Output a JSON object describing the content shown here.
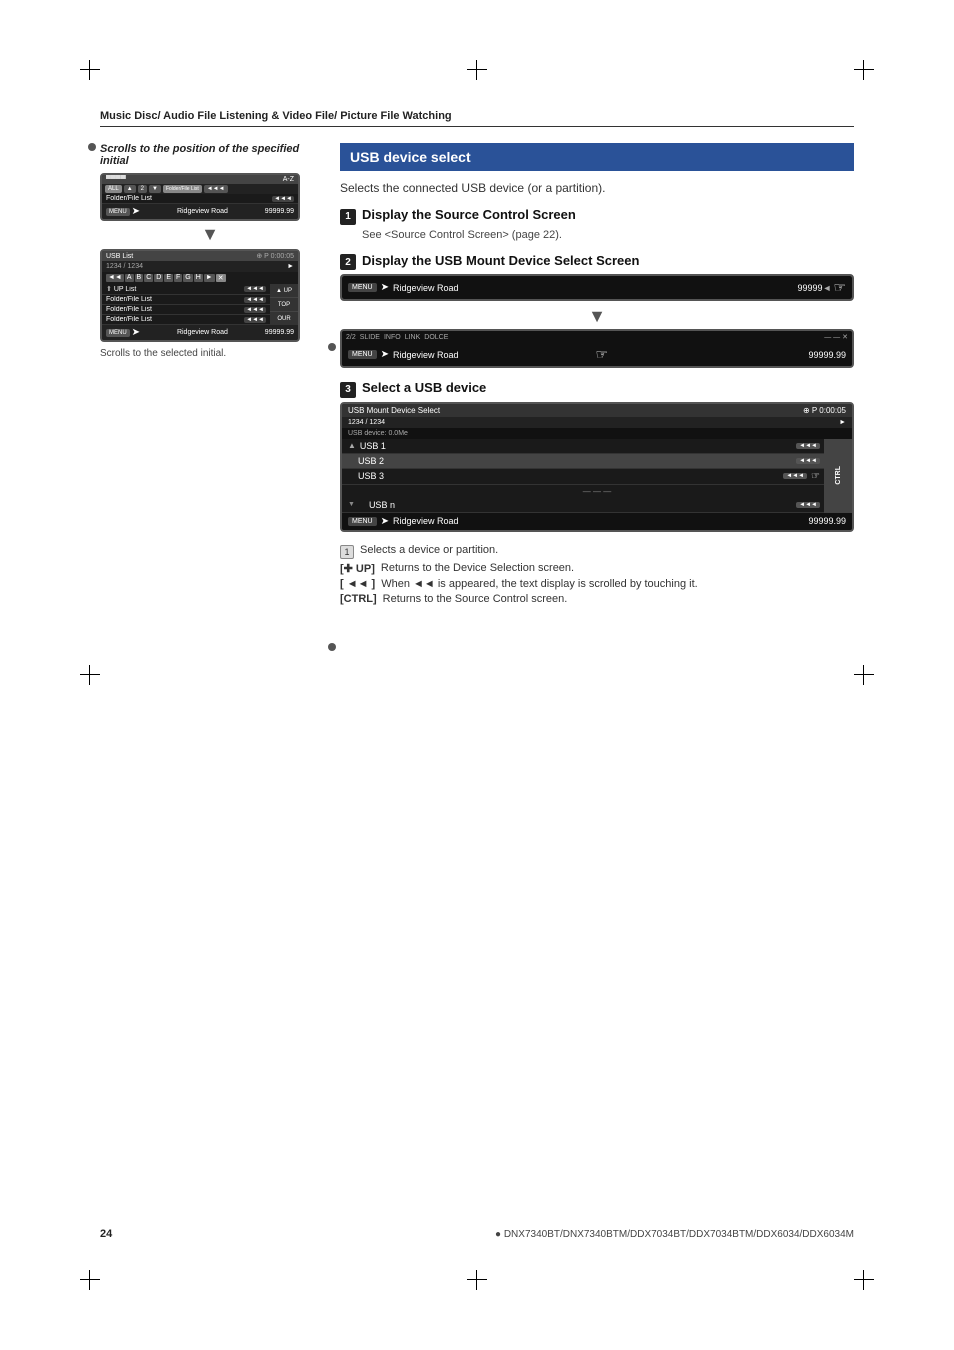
{
  "page": {
    "header": "Music Disc/ Audio File Listening & Video File/ Picture File Watching",
    "number": "24",
    "models": "● DNX7340BT/DNX7340BTM/DDX7034BT/DDX7034BTM/DDX6034/DDX6034M"
  },
  "left_section": {
    "caption": "Scrolls to the position of the specified initial",
    "scroll_note": "Scrolls to the selected initial.",
    "screen": {
      "top_tabs": [
        "ALL",
        "▲",
        "2",
        "▼",
        "Folder/File List",
        "◄◄◄",
        "A-Z"
      ],
      "folder_row": "Folder/File List",
      "usb_list_label": "USB List",
      "time_label": "P 0:00:05",
      "rows": [
        {
          "label": "1234 / 1234",
          "cols": [
            "◄◄",
            "A",
            "B",
            "C",
            "D",
            "E",
            "F",
            "G",
            "H",
            "►"
          ]
        },
        {
          "label": "UP List",
          "scroll": "◄◄◄"
        },
        {
          "label": "Folder/File List",
          "scroll": "◄◄◄"
        },
        {
          "label": "Folder/File List",
          "scroll": "◄◄◄"
        },
        {
          "label": "Folder/File List",
          "scroll": "◄◄◄"
        }
      ],
      "side_buttons": [
        "UP",
        "TOP",
        "OUR"
      ],
      "nav_label": "Ridgeview Road",
      "nav_num": "99999.99"
    }
  },
  "right_section": {
    "title": "USB device select",
    "intro": "Selects the connected USB device (or a partition).",
    "steps": [
      {
        "num": "1",
        "title": "Display the Source Control Screen",
        "desc": "See <Source Control Screen> (page 22)."
      },
      {
        "num": "2",
        "title": "Display the USB Mount Device Select Screen",
        "screen1": {
          "menu_btn": "MENU",
          "addr": "Ridgeview Road",
          "num": "99999",
          "finger": "☞"
        },
        "screen2": {
          "items": [
            "2/2",
            "SLIDE",
            "INFO",
            "LINK",
            "DOLCE"
          ],
          "addr": "Ridgeview Road",
          "finger": "☞",
          "num": "99999.99"
        }
      },
      {
        "num": "3",
        "title": "Select a USB device",
        "screen": {
          "title": "USB Mount Device Select",
          "time": "P 0:00:05",
          "subheader": "1234 / 1234",
          "device_label": "USB device: 0.0Me",
          "devices": [
            "USB 1",
            "USB 2",
            "USB 3",
            "USB n"
          ],
          "nav_label": "Ridgeview Road",
          "nav_num": "99999.99"
        }
      }
    ],
    "notes": [
      {
        "key": "1",
        "text": "Selects a device or partition."
      },
      {
        "key": "[✚ UP]",
        "text": "Returns to the Device Selection screen."
      },
      {
        "key": "[ ◄◄ ]",
        "text": "When ◄◄ is appeared, the text display is scrolled by touching it."
      },
      {
        "key": "[CTRL]",
        "text": "Returns to the Source Control screen."
      }
    ]
  }
}
